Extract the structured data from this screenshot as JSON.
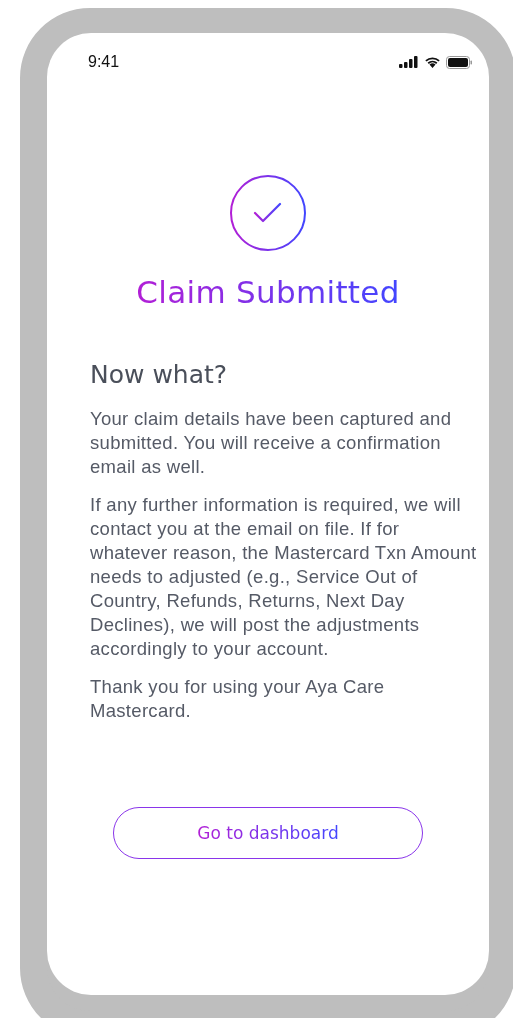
{
  "status_bar": {
    "time": "9:41"
  },
  "title": "Claim Submitted",
  "heading": "Now what?",
  "paragraphs": [
    "Your claim details have been captured and submitted.  You will receive a confirmation email as well.",
    "If any further information is required, we will contact you at the email on file.  If for whatever reason, the Mastercard Txn Amount needs to adjusted (e.g., Service Out of Country, Refunds, Returns, Next Day Declines), we will post the adjustments accordingly to your account.",
    "Thank you for using your Aya Care Mastercard."
  ],
  "button": "Go to dashboard"
}
